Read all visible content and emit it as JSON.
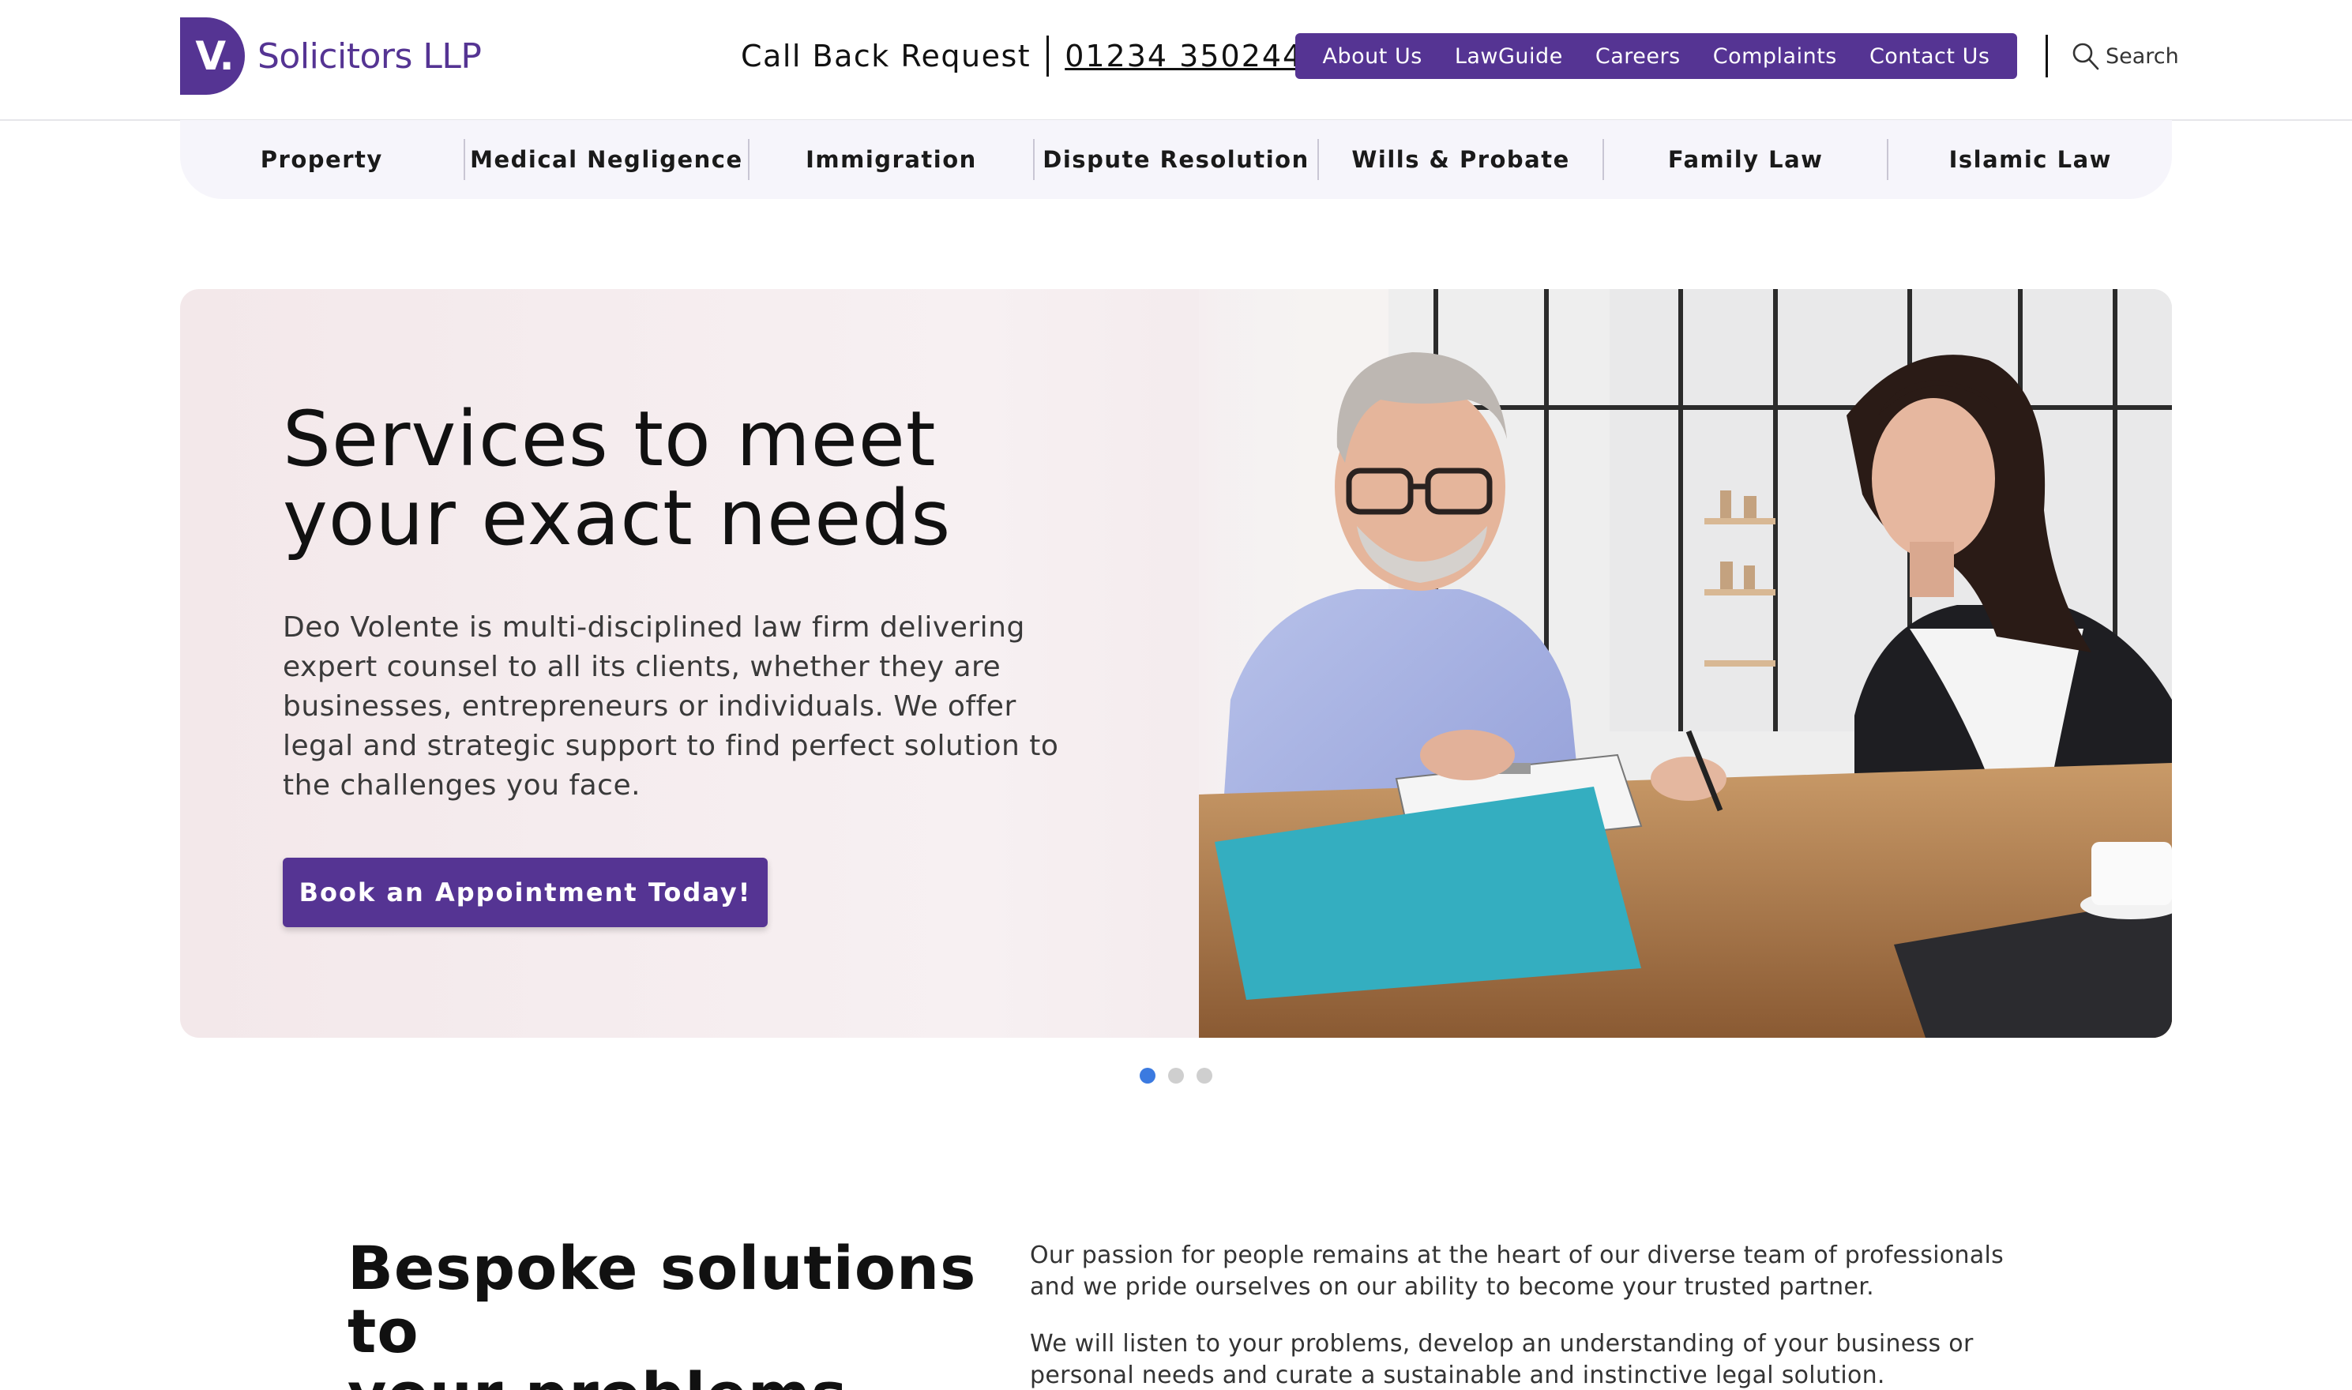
{
  "brand": {
    "logo_letter": "V.",
    "name": "Solicitors LLP",
    "color": "#553493"
  },
  "header": {
    "callback_label": "Call Back Request",
    "phone": "01234 350244",
    "nav": [
      "About Us",
      "LawGuide",
      "Careers",
      "Complaints",
      "Contact Us"
    ],
    "search_label": "Search"
  },
  "categories": [
    "Property",
    "Medical Negligence",
    "Immigration",
    "Dispute Resolution",
    "Wills & Probate",
    "Family Law",
    "Islamic Law"
  ],
  "hero": {
    "title_line1": "Services to meet",
    "title_line2": "your exact needs",
    "text": "Deo Volente is multi-disciplined law firm delivering expert counsel to all its clients, whether they are businesses, entrepreneurs or individuals. We offer legal and strategic support to find perfect solution to the challenges you face.",
    "button": "Book an Appointment Today!",
    "slides_total": 3,
    "active_slide": 1,
    "active_dot_color": "#3b7ae0"
  },
  "bespoke": {
    "title_line1": "Bespoke solutions to",
    "title_line2": "your problems",
    "para1": "Our passion for people remains at the heart of our diverse team of professionals and we pride ourselves on our ability to become your trusted partner.",
    "para2": "We will listen to your problems, develop an understanding of your business or personal needs and curate a sustainable and instinctive legal solution."
  }
}
